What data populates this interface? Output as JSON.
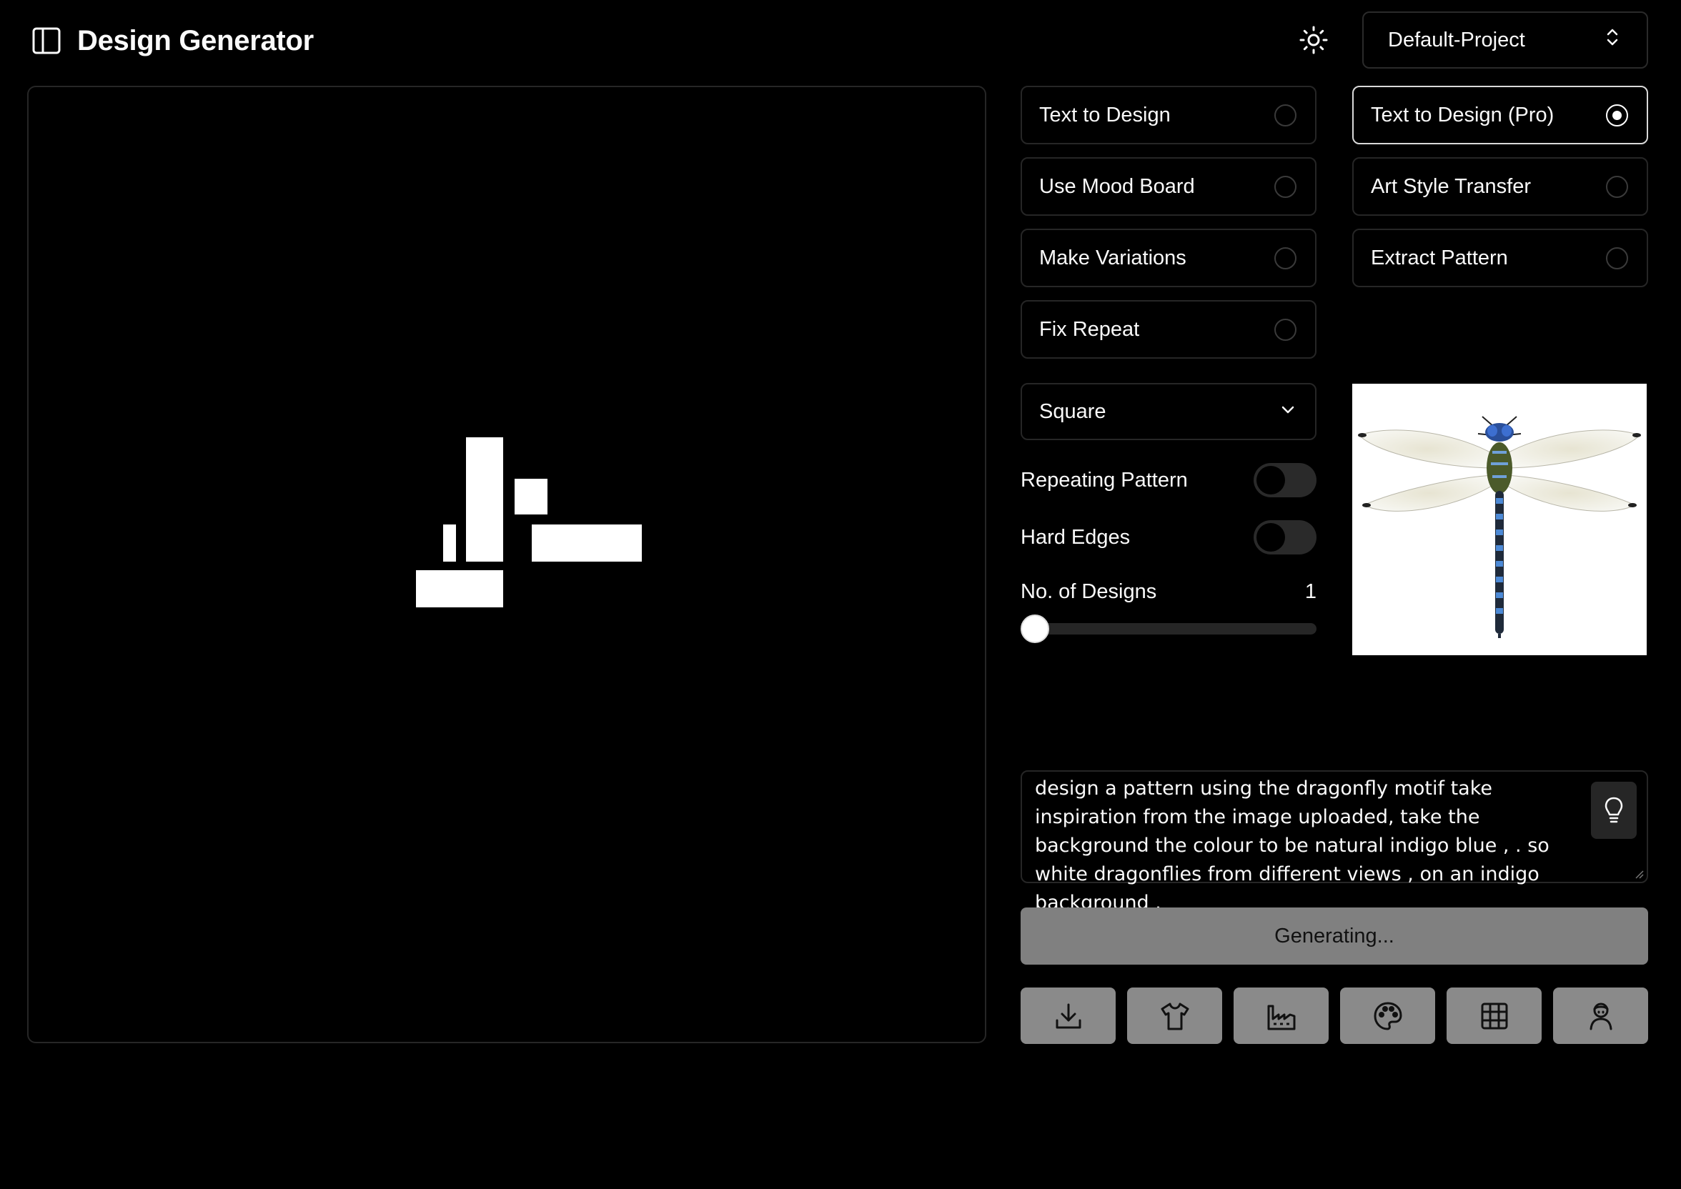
{
  "app": {
    "title": "Design Generator"
  },
  "header": {
    "project": "Default-Project"
  },
  "modes": [
    {
      "label": "Text to Design",
      "selected": false
    },
    {
      "label": "Text to Design (Pro)",
      "selected": true
    },
    {
      "label": "Use Mood Board",
      "selected": false
    },
    {
      "label": "Art Style Transfer",
      "selected": false
    },
    {
      "label": "Make Variations",
      "selected": false
    },
    {
      "label": "Extract Pattern",
      "selected": false
    },
    {
      "label": "Fix Repeat",
      "selected": false
    }
  ],
  "settings": {
    "aspect": "Square",
    "repeating_label": "Repeating Pattern",
    "repeating_on": false,
    "hard_edges_label": "Hard Edges",
    "hard_edges_on": false,
    "designs_label": "No. of Designs",
    "designs_value": "1",
    "designs_fraction": 0
  },
  "prompt": {
    "text": "design a pattern using the dragonfly motif take inspiration from the image uploaded, take the background the colour to be natural indigo blue , . so white dragonflies from different views , on an indigo background ."
  },
  "generate": {
    "label": "Generating..."
  },
  "actions": [
    {
      "icon": "download-icon"
    },
    {
      "icon": "tshirt-icon"
    },
    {
      "icon": "factory-icon"
    },
    {
      "icon": "palette-icon"
    },
    {
      "icon": "grid-icon"
    },
    {
      "icon": "avatar-icon"
    }
  ]
}
